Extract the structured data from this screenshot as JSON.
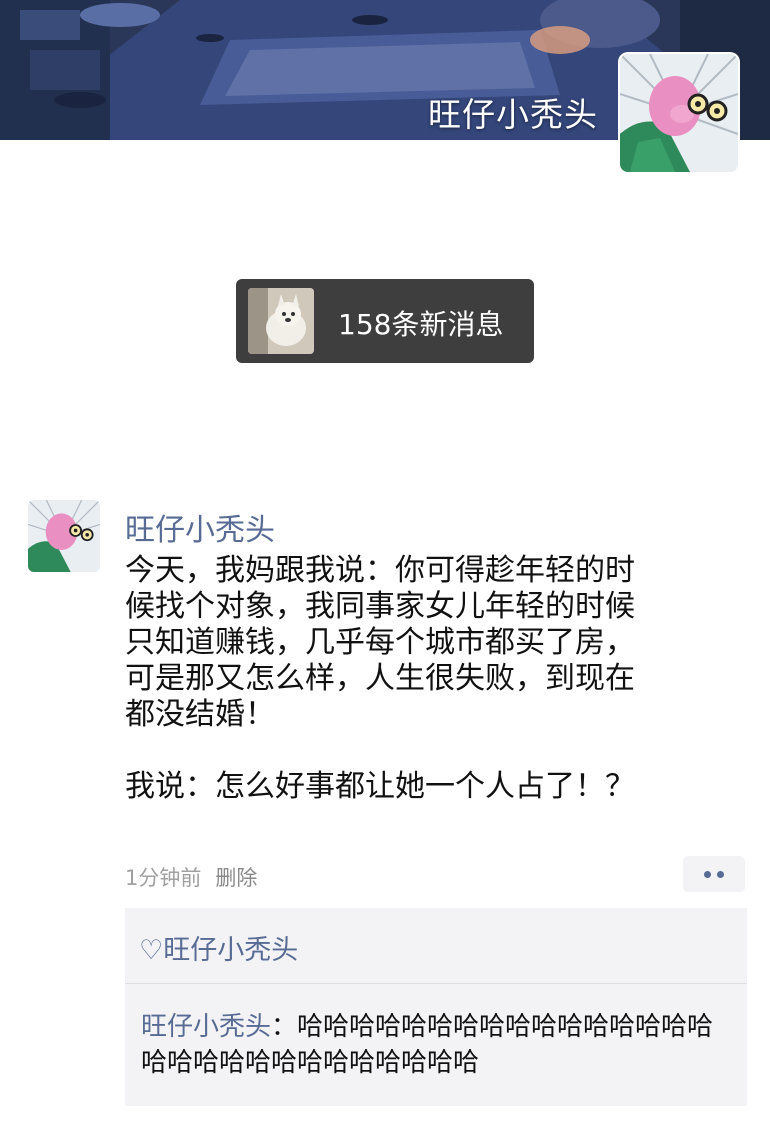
{
  "profile": {
    "name": "旺仔小秃头"
  },
  "new_messages": {
    "label": "158条新消息"
  },
  "post": {
    "author": "旺仔小秃头",
    "lines": [
      "今天，我妈跟我说：你可得趁年轻的时",
      "候找个对象，我同事家女儿年轻的时候",
      "只知道赚钱，几乎每个城市都买了房，",
      "可是那又怎么样，人生很失败，到现在",
      "都没结婚！",
      "我说：怎么好事都让她一个人占了！？"
    ],
    "time": "1分钟前",
    "delete_label": "删除"
  },
  "likes": {
    "icon": "heart-icon",
    "text": "♡旺仔小秃头"
  },
  "comments": [
    {
      "author": "旺仔小秃头",
      "separator": "：",
      "text": "哈哈哈哈哈哈哈哈哈哈哈哈哈哈哈哈哈哈哈哈哈哈哈哈哈哈哈哈哈"
    }
  ],
  "colors": {
    "link": "#576b95",
    "text": "#111111",
    "meta": "#a0a0a0",
    "toast_bg": "#3e3e3e"
  }
}
